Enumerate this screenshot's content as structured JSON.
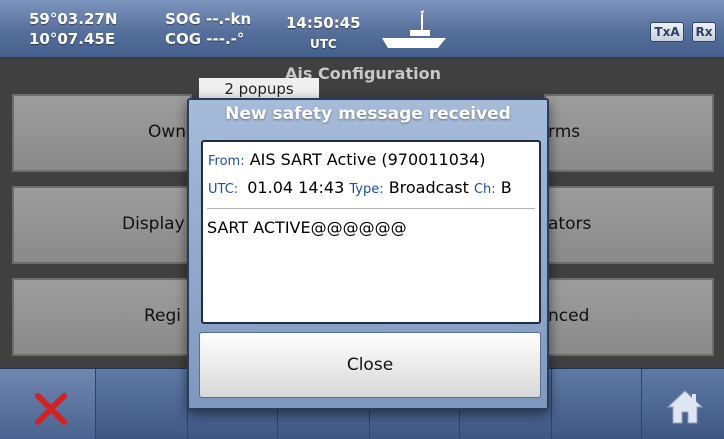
{
  "status": {
    "lat": "59°03.27N",
    "lon": "10°07.45E",
    "sog": "SOG --.-kn",
    "cog": "COG ---.-°",
    "time": "14:50:45",
    "tz": "UTC",
    "txa": "TxA",
    "rx": "Rx"
  },
  "background": {
    "screen_title": "Ais Configuration",
    "popups_label": "2 popups",
    "tiles": {
      "own": "Own",
      "display": "Display",
      "regi": "Regi",
      "alarms_fragment": "rms",
      "indicators_fragment": "ators",
      "advanced_fragment": "nced"
    }
  },
  "dialog": {
    "title": "New safety message received",
    "from_label": "From:",
    "from_value": "AIS SART Active (970011034)",
    "utc_label": "UTC:",
    "utc_value": "01.04 14:43",
    "type_label": "Type:",
    "type_value": "Broadcast",
    "ch_label": "Ch:",
    "ch_value": "B",
    "body": "SART ACTIVE@@@@@@",
    "close_label": "Close"
  },
  "colors": {
    "status_bar": "#566f9b",
    "dialog_frame": "#8ea4c9",
    "label_blue": "#1d4f9a",
    "cancel_red": "#d02424"
  },
  "icons": {
    "ship": "ship-icon",
    "cancel": "x-icon",
    "home": "home-icon"
  }
}
